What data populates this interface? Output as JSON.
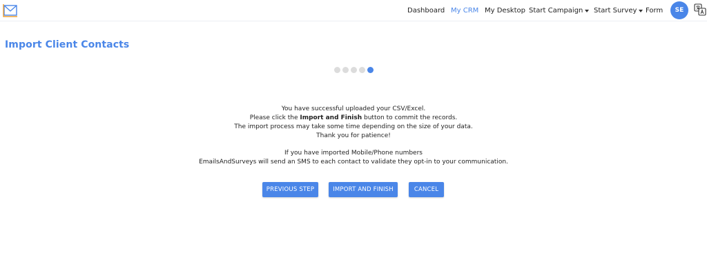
{
  "header": {
    "nav": [
      {
        "label": "Dashboard",
        "active": false
      },
      {
        "label": "My CRM",
        "active": true
      },
      {
        "label": "My Desktop",
        "active": false
      },
      {
        "label": "Start Campaign",
        "active": false,
        "dropdown": true
      },
      {
        "label": "Start Survey",
        "active": false,
        "dropdown": true
      },
      {
        "label": "Form",
        "active": false
      }
    ],
    "avatar_initials": "SE",
    "logo_icon": "envelope-logo-icon",
    "translate_icon": "translate-icon"
  },
  "page": {
    "title": "Import Client Contacts"
  },
  "steps": {
    "total": 5,
    "current": 5
  },
  "message": {
    "line1": "You have successful uploaded your CSV/Excel.",
    "line2_pre": "Please click the ",
    "line2_bold": "Import and Finish",
    "line2_post": " button to commit the records.",
    "line3": "The import process may take some time depending on the size of your data.",
    "line4": "Thank you for patience!",
    "line5": "If you have imported Mobile/Phone numbers",
    "line6": "EmailsAndSurveys will send an SMS to each contact to validate they opt-in to your communication."
  },
  "buttons": {
    "previous": "PREVIOUS STEP",
    "import": "IMPORT AND FINISH",
    "cancel": "CANCEL"
  },
  "colors": {
    "accent": "#4a86e8",
    "inactive_dot": "#dcdcdc"
  }
}
